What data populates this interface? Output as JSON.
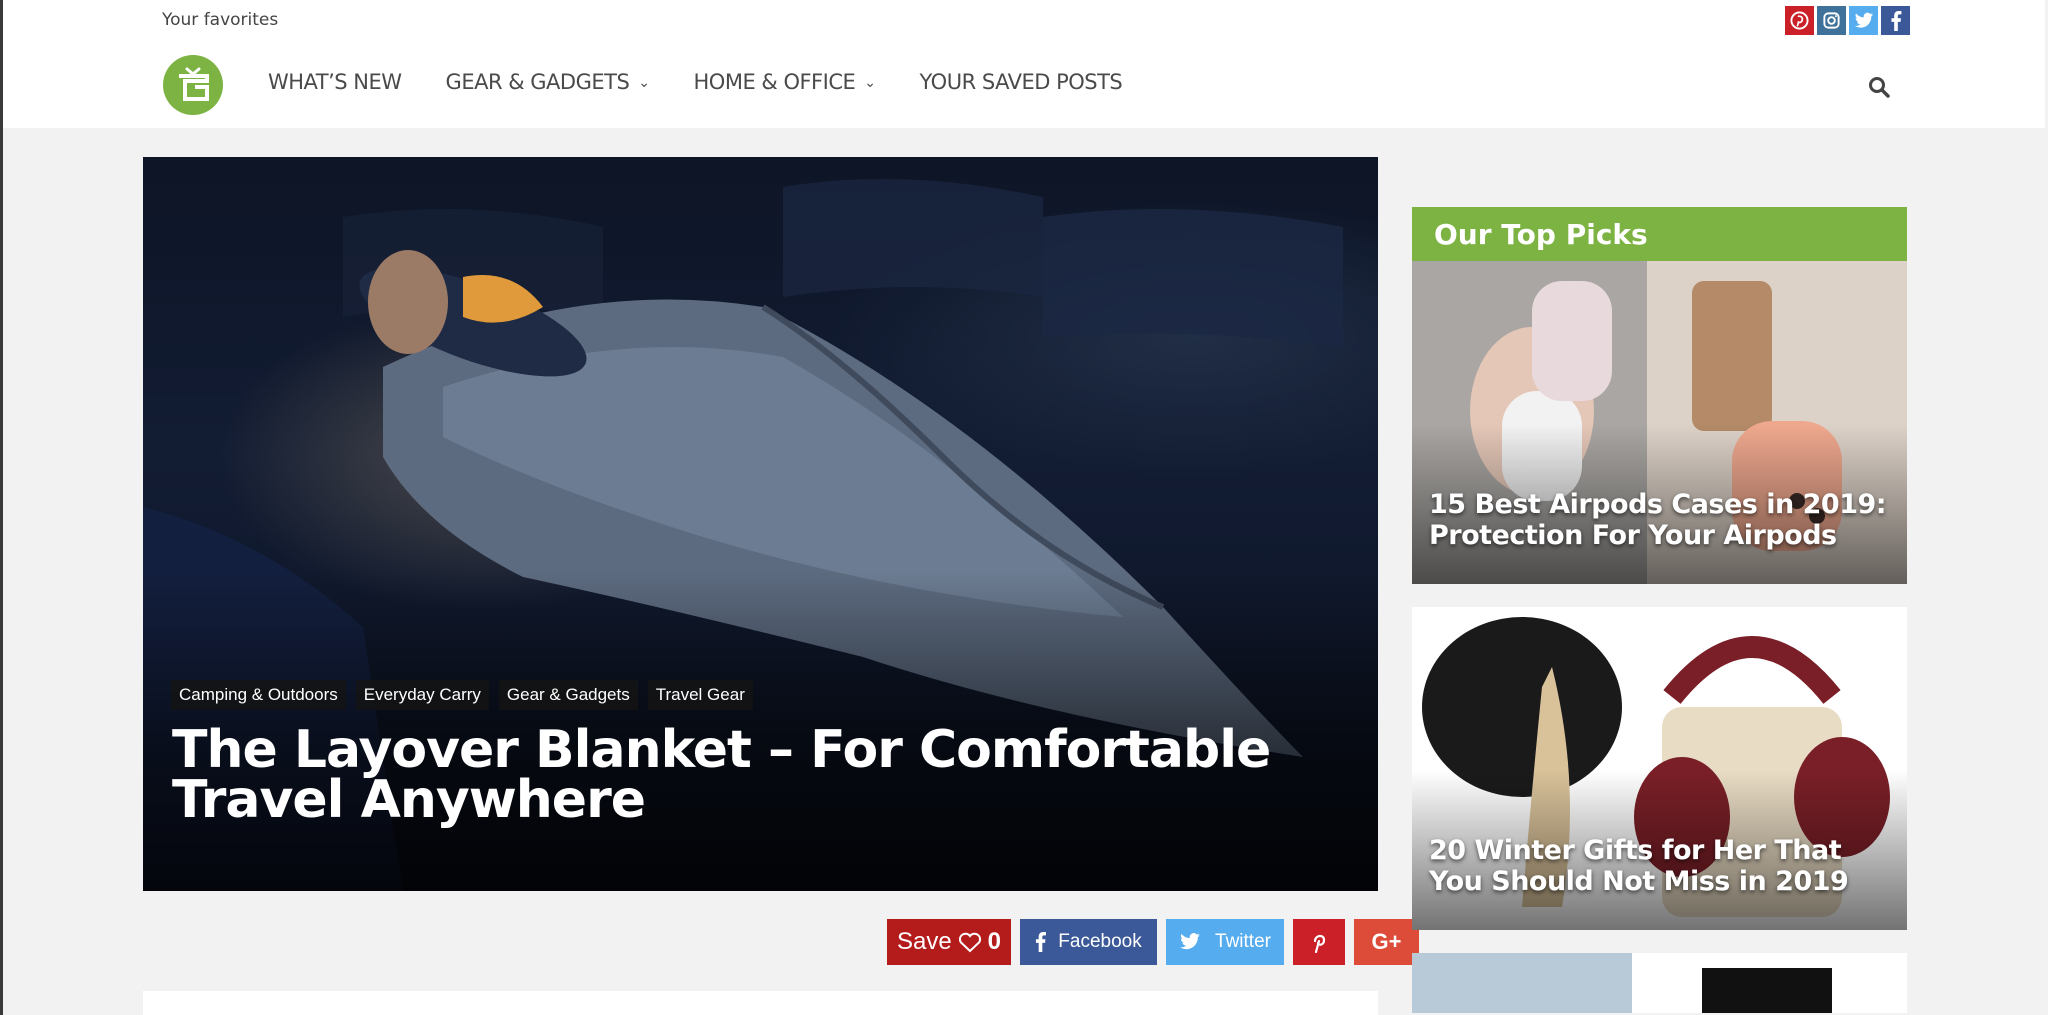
{
  "header": {
    "tagline": "Your favorites",
    "social": [
      "pinterest-icon",
      "instagram-icon",
      "twitter-icon",
      "facebook-icon"
    ],
    "nav": [
      {
        "label": "WHAT’S NEW",
        "dropdown": false
      },
      {
        "label": "GEAR & GADGETS",
        "dropdown": true
      },
      {
        "label": "HOME & OFFICE",
        "dropdown": true
      },
      {
        "label": "YOUR SAVED POSTS",
        "dropdown": false
      }
    ],
    "brand_color": "#7cb342"
  },
  "hero": {
    "tags": [
      "Camping & Outdoors",
      "Everyday Carry",
      "Gear & Gadgets",
      "Travel Gear"
    ],
    "title": "The Layover Blanket – For Comfortable Travel Anywhere"
  },
  "share": {
    "save_label": "Save",
    "save_count": "0",
    "facebook_label": "Facebook",
    "twitter_label": "Twitter",
    "google_label": "G+"
  },
  "sidebar": {
    "heading": "Our Top Picks",
    "picks": [
      {
        "title": "15 Best Airpods Cases in 2019: Protection For Your Airpods"
      },
      {
        "title": "20 Winter Gifts for Her That You Should Not Miss in 2019"
      }
    ]
  }
}
